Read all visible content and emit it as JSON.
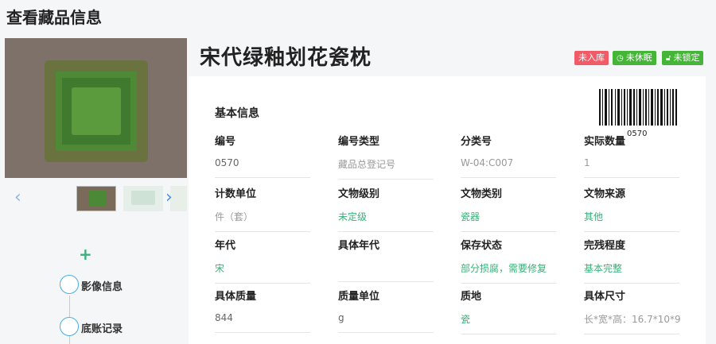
{
  "page_title": "查看藏品信息",
  "artifact_name": "宋代绿釉划花瓷枕",
  "badges": [
    {
      "label": "未入库",
      "color": "#f05b67"
    },
    {
      "label": "未休眠",
      "color": "#45b537",
      "icon": "clock-icon"
    },
    {
      "label": "未锁定",
      "color": "#45b537",
      "icon": "lock-icon"
    }
  ],
  "section_title": "基本信息",
  "barcode_number": "0570",
  "fields": [
    {
      "label": "编号",
      "value": "0570",
      "style": "plain"
    },
    {
      "label": "编号类型",
      "value": "藏品总登记号",
      "style": "grey"
    },
    {
      "label": "分类号",
      "value": "W-04:C007",
      "style": "grey"
    },
    {
      "label": "实际数量",
      "value": "1",
      "style": "grey"
    },
    {
      "label": "计数单位",
      "value": "件（套）",
      "style": "grey"
    },
    {
      "label": "文物级别",
      "value": "未定级",
      "style": "green"
    },
    {
      "label": "文物类别",
      "value": "瓷器",
      "style": "green"
    },
    {
      "label": "文物来源",
      "value": "其他",
      "style": "green"
    },
    {
      "label": "年代",
      "value": "宋",
      "style": "green"
    },
    {
      "label": "具体年代",
      "value": "",
      "style": "grey"
    },
    {
      "label": "保存状态",
      "value": "部分损腐，需要修复",
      "style": "green"
    },
    {
      "label": "完残程度",
      "value": "基本完整",
      "style": "green"
    },
    {
      "label": "具体质量",
      "value": "844",
      "style": "plain"
    },
    {
      "label": "质量单位",
      "value": "g",
      "style": "plain"
    },
    {
      "label": "质地",
      "value": "瓷",
      "style": "green"
    },
    {
      "label": "具体尺寸",
      "value": "长*宽*高：16.7*10*9",
      "style": "grey"
    }
  ],
  "timeline": [
    {
      "label": "影像信息"
    },
    {
      "label": "底账记录"
    }
  ],
  "gallery": {
    "prev_icon": "chevron-left-icon",
    "next_icon": "chevron-right-icon",
    "add_icon": "plus-icon"
  }
}
